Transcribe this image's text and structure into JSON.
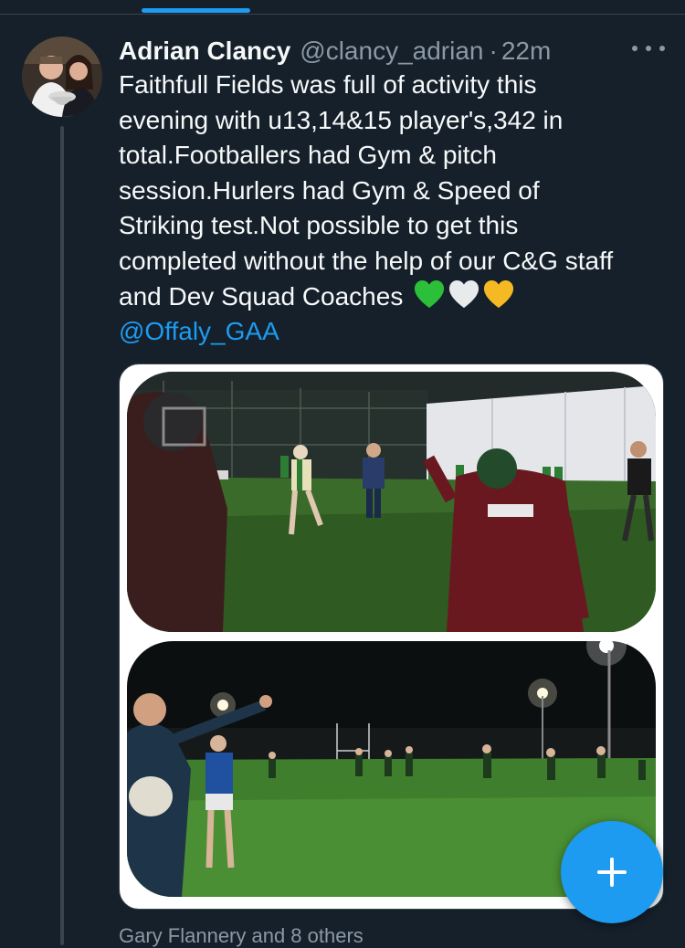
{
  "tweet": {
    "author_name": "Adrian Clancy",
    "handle": "@clancy_adrian",
    "separator": "·",
    "time": "22m",
    "text_lines": [
      "Faithfull Fields was full of activity this",
      "evening with u13,14&15 player's,342 in",
      "total.Footballers had Gym & pitch",
      "session.Hurlers had Gym & Speed of",
      "Striking test.Not possible to get this",
      "completed without the help of our C&G staff",
      "and Dev Squad Coaches"
    ],
    "emojis": [
      "green-heart",
      "white-heart",
      "yellow-heart"
    ],
    "mention": "@Offaly_GAA"
  },
  "liked_by": "Gary Flannery and 8 others",
  "colors": {
    "background": "#15202b",
    "accent": "#1d9bf0",
    "secondary_text": "#8b98a5",
    "divider": "#38444d"
  },
  "icons": {
    "more": "more-horizontal-icon",
    "compose": "plus-icon"
  }
}
